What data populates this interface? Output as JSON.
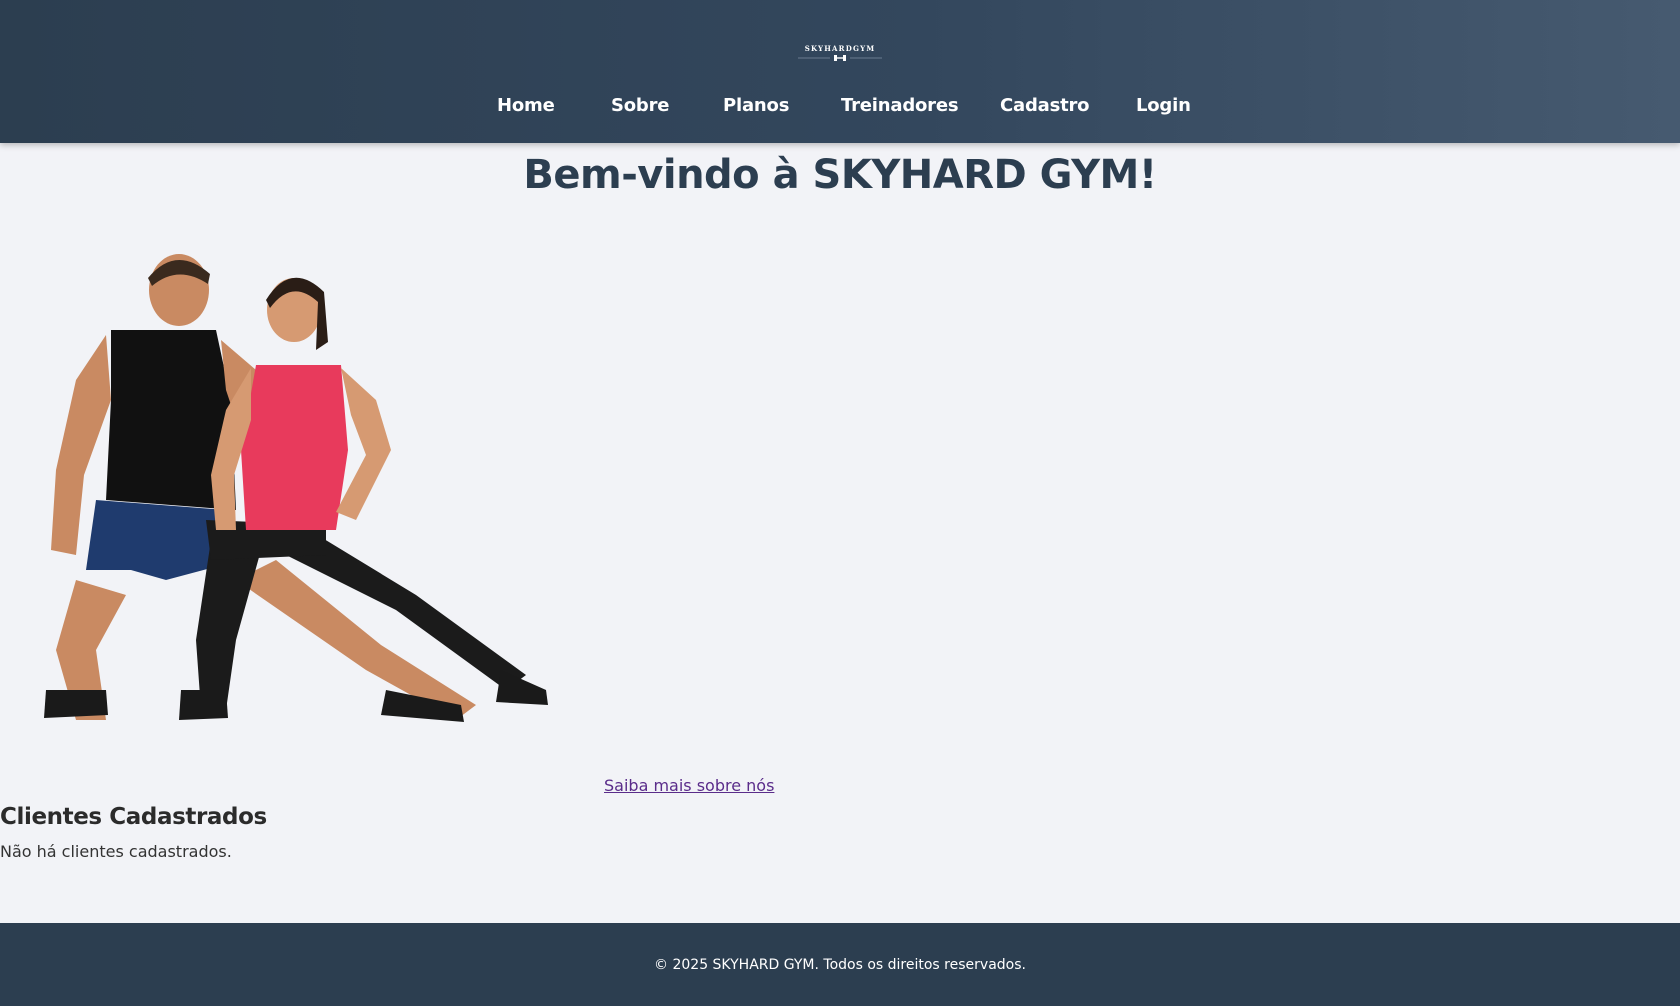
{
  "header": {
    "logo_text": "SKYHARDGYM",
    "nav": [
      {
        "label": "Home"
      },
      {
        "label": "Sobre"
      },
      {
        "label": "Planos"
      },
      {
        "label": "Treinadores"
      },
      {
        "label": "Cadastro"
      },
      {
        "label": "Login"
      }
    ]
  },
  "main": {
    "title": "Bem-vindo à SKYHARD GYM!",
    "hero_image": "fitness-couple-stretching-photo",
    "about_link": "Saiba mais sobre nós",
    "clients_heading": "Clientes Cadastrados",
    "clients_empty": "Não há clientes cadastrados."
  },
  "footer": {
    "text": "© 2025 SKYHARD GYM. Todos os direitos reservados."
  },
  "colors": {
    "header_bg": "#2c3e50",
    "page_bg": "#f2f3f7",
    "title": "#2c3e50",
    "link_visited": "#5a2c8a",
    "top_woman": "#e83a5c",
    "shorts_man": "#1f3b6e"
  }
}
